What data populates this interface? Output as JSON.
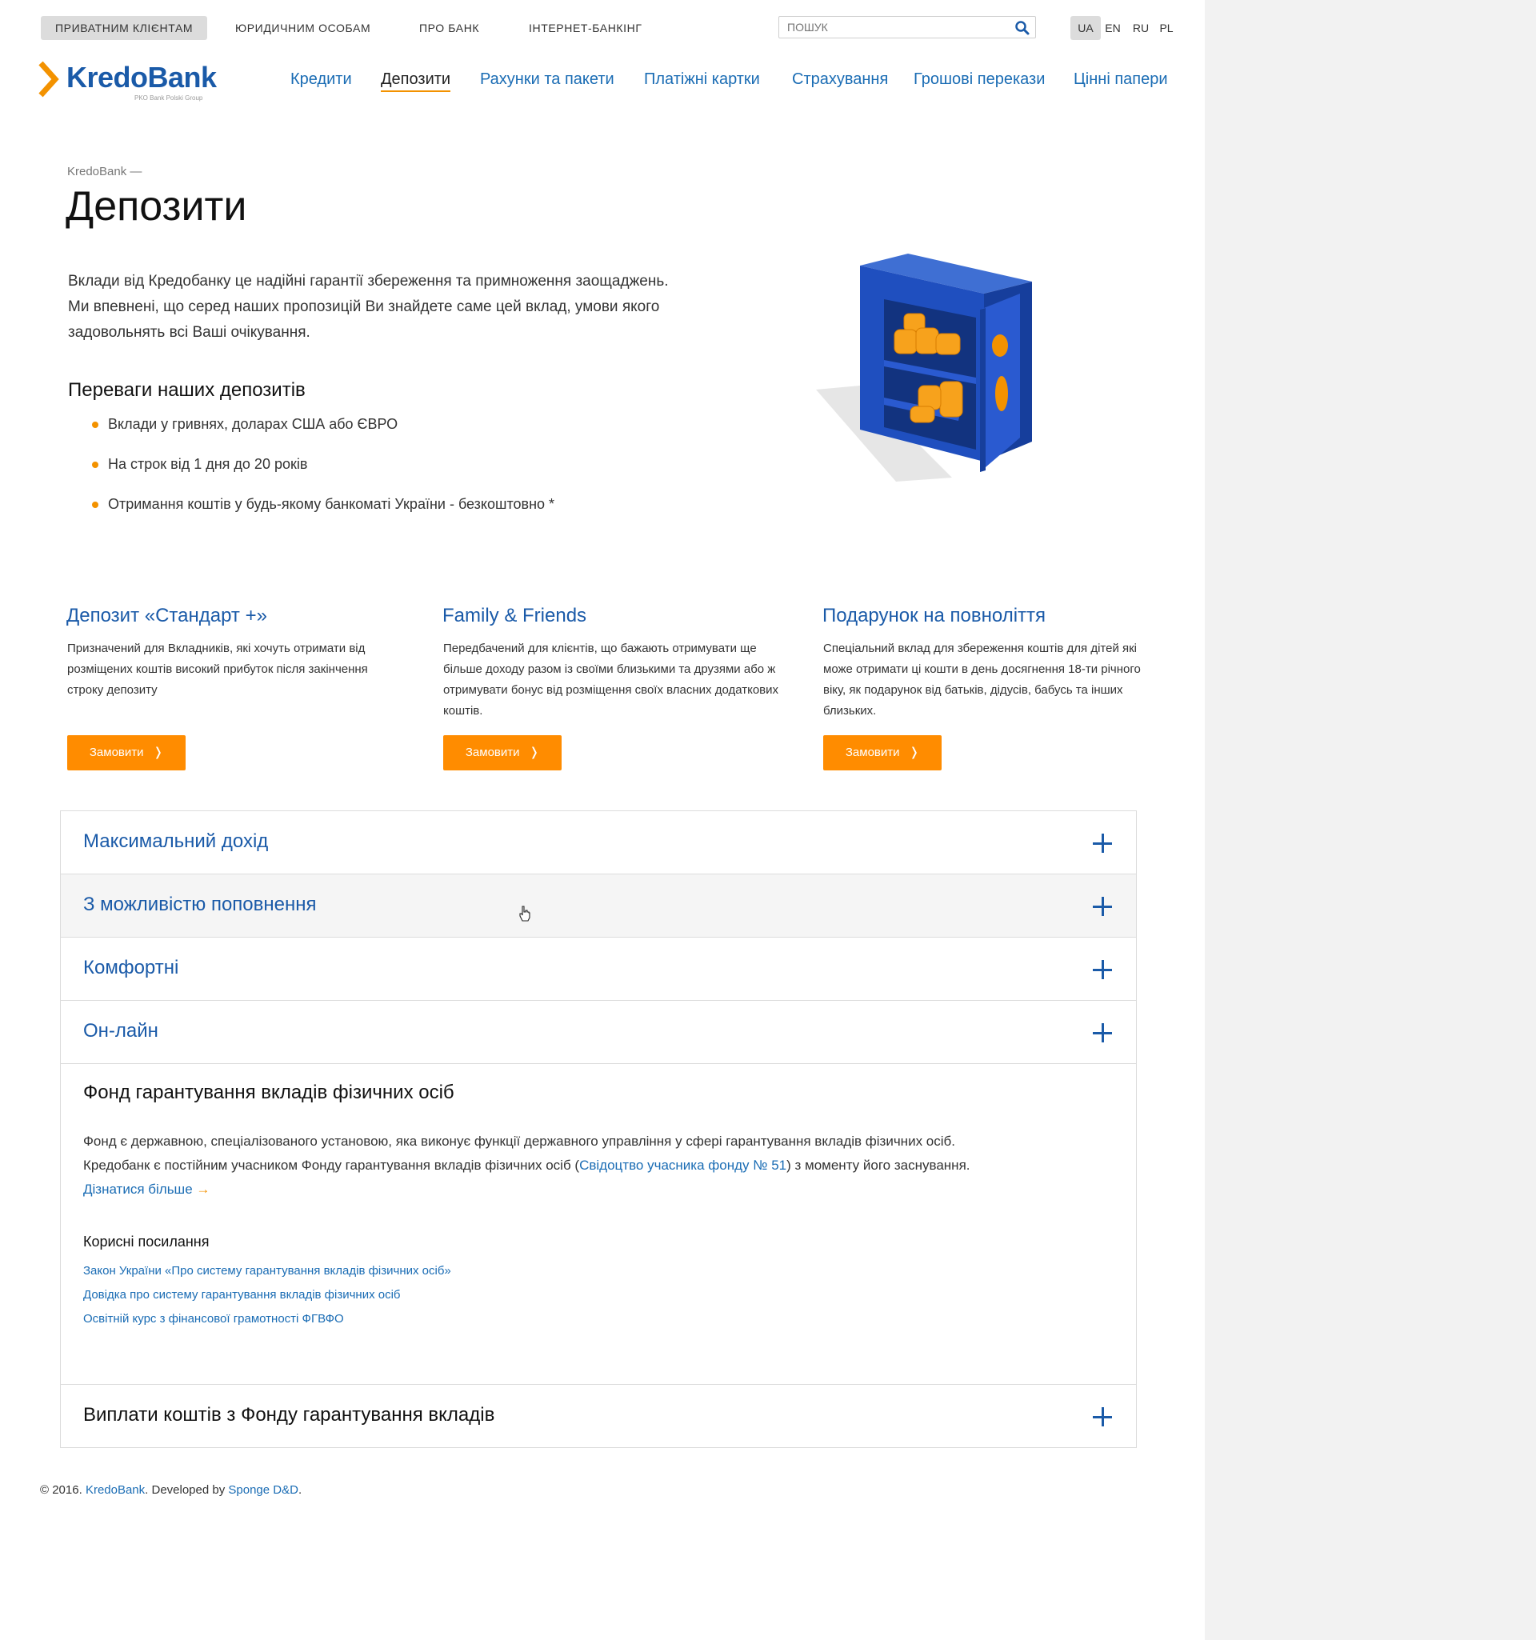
{
  "top_nav": {
    "items": [
      "ПРИВАТНИМ КЛІЄНТАМ",
      "ЮРИДИЧНИМ ОСОБАМ",
      "ПРО БАНК",
      "ІНТЕРНЕТ-БАНКІНГ"
    ],
    "active_index": 0
  },
  "search": {
    "placeholder": "ПОШУК",
    "icon": "search-icon"
  },
  "languages": {
    "items": [
      "UA",
      "EN",
      "RU",
      "PL"
    ],
    "active": "UA"
  },
  "logo": {
    "name": "KredoBank",
    "subtitle": "PKO Bank Polski Group"
  },
  "main_nav": {
    "items": [
      "Кредити",
      "Депозити",
      "Рахунки та пакети",
      "Платіжні картки",
      "Страхування",
      "Грошові перекази",
      "Цінні папери"
    ],
    "current": "Депозити"
  },
  "breadcrumb": "KredoBank —",
  "page_title": "Депозити",
  "intro": "Вклади від Кредобанку це надійні гарантії збереження та примноження заощаджень. Ми впевнені, що серед наших пропозицій Ви знайдете саме цей вклад, умови якого задовольнять всі Ваші очікування.",
  "advantages": {
    "title": "Переваги наших депозитів",
    "items": [
      "Вклади у гривнях, доларах США або ЄВРО",
      "На строк від 1 дня до 20 років",
      "Отримання коштів у будь-якому банкоматі України - безкоштовно *"
    ]
  },
  "products": [
    {
      "title": "Депозит «Стандарт +»",
      "description": "Призначений для Вкладників, які хочуть отримати від розміщених коштів високий прибуток після закінчення строку депозиту",
      "button": "Замовити"
    },
    {
      "title": "Family & Friends",
      "description": "Передбачений для клієнтів, що бажають отримувати ще більше доходу разом із своїми близькими та друзями або ж отримувати бонус від розміщення своїх власних додаткових коштів.",
      "button": "Замовити"
    },
    {
      "title": "Подарунок на повноліття",
      "description": "Спеціальний вклад для збереження коштів для дітей які може отримати ці кошти в день досягнення 18-ти річного віку, як подарунок від батьків, дідусів, бабусь та інших близьких.",
      "button": "Замовити"
    }
  ],
  "accordion": {
    "items": [
      "Максимальний дохід",
      "З можливістю поповнення",
      "Комфортні",
      "Он-лайн"
    ],
    "hovered_index": 1
  },
  "fund": {
    "title": "Фонд гарантування вкладів фізичних осіб",
    "text_part1": "Фонд є державною, спеціалізованого установою, яка виконує функції державного управління у сфері гарантування вкладів фізичних осіб. Кредобанк є постійним учасником Фонду гарантування вкладів фізичних осіб (",
    "certificate_link": "Свідоцтво учасника фонду № 51",
    "text_part2": ") з моменту його заснування. ",
    "more_link": "Дізнатися більше",
    "more_arrow": "→",
    "links_title": "Корисні посилання",
    "links": [
      "Закон України «Про систему гарантування вкладів фізичних осіб»",
      "Довідка про систему гарантування вкладів фізичних осіб",
      "Освітній курс з фінансової грамотності ФГВФО"
    ]
  },
  "payouts": {
    "title": "Виплати коштів з Фонду гарантування вкладів"
  },
  "footer": {
    "prefix": "© 2016. ",
    "bank_link": "KredoBank",
    "middle": ". Developed by ",
    "dev_link": "Sponge D&D",
    "suffix": "."
  },
  "colors": {
    "brand_blue": "#1a5aa8",
    "accent_orange": "#ff8c00",
    "link_blue": "#1a6cb4"
  }
}
